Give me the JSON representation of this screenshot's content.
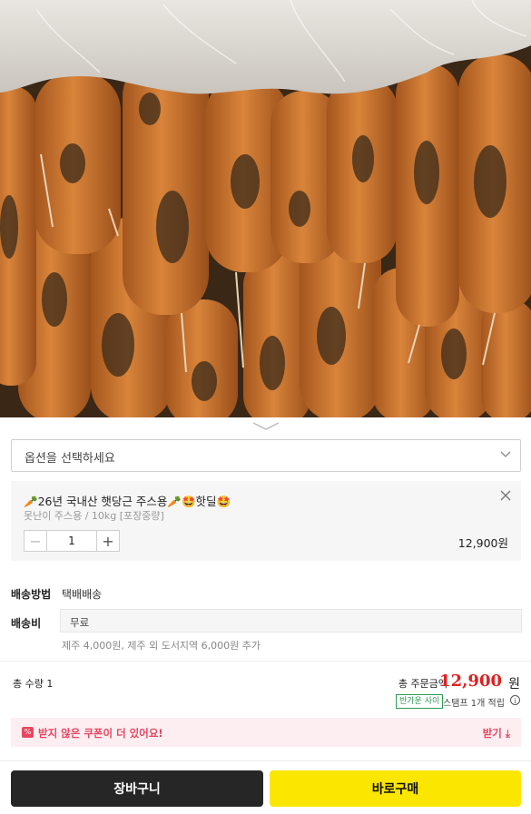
{
  "product_image": {
    "alt": ""
  },
  "option_select": {
    "placeholder": "옵션을 선택하세요"
  },
  "selected_option": {
    "title": "🥕26년 국내산 햇당근 주스용🥕🤩핫딜🤩",
    "subtitle": "못난이 주스용 / 10kg [포장중량]",
    "quantity": "1",
    "price": "12,900원"
  },
  "shipping": {
    "method_label": "배송방법",
    "method_value": "택배배송",
    "fee_label": "배송비",
    "fee_value": "무료",
    "fee_note": "제주 4,000원, 제주 외 도서지역 6,000원 추가"
  },
  "summary": {
    "total_qty": "총 수량 1",
    "total_label": "총 주문금액",
    "total_amount": "12,900",
    "currency": "원",
    "stamp_badge": "반가운 사이",
    "stamp_text": "스탬프 1개 적립"
  },
  "coupon": {
    "icon_text": "%",
    "text": "받지 않은 쿠폰이 더 있어요!",
    "action": "받기"
  },
  "actions": {
    "cart": "장바구니",
    "buy": "바로구매"
  },
  "colors": {
    "accent_red": "#e02020",
    "buy_yellow": "#fbe600",
    "cart_dark": "#262626",
    "coupon_pink": "#e8465f"
  }
}
